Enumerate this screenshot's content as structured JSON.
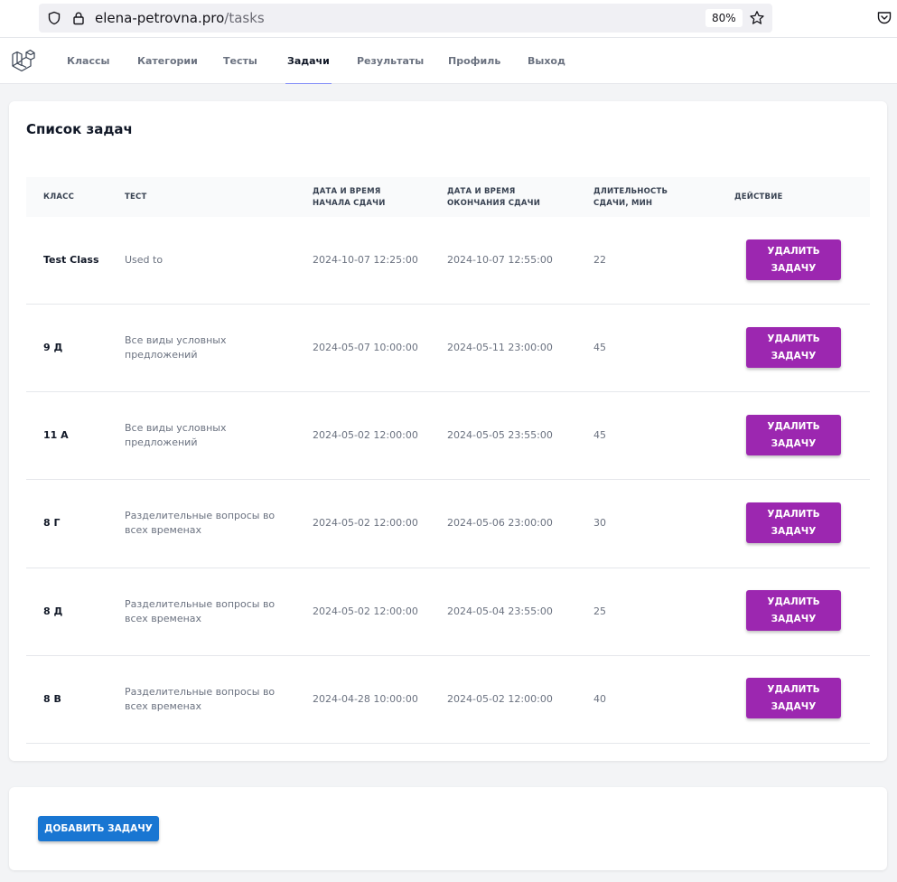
{
  "browser": {
    "url_domain": "elena-petrovna.pro",
    "url_path": "/tasks",
    "zoom": "80%"
  },
  "nav": {
    "items": [
      {
        "label": "Классы"
      },
      {
        "label": "Категории"
      },
      {
        "label": "Тесты"
      },
      {
        "label": "Задачи"
      },
      {
        "label": "Результаты"
      },
      {
        "label": "Профиль"
      },
      {
        "label": "Выход"
      }
    ],
    "active": "Задачи"
  },
  "page": {
    "title": "Список задач"
  },
  "table": {
    "headers": {
      "class": "КЛАСС",
      "test": "ТЕСТ",
      "start_1": "ДАТА И ВРЕМЯ",
      "start_2": "НАЧАЛА СДАЧИ",
      "end_1": "ДАТА И ВРЕМЯ",
      "end_2": "ОКОНЧАНИЯ СДАЧИ",
      "duration_1": "ДЛИТЕЛЬНОСТЬ",
      "duration_2": "СДАЧИ, МИН",
      "action": "ДЕЙСТВИЕ"
    },
    "rows": [
      {
        "class": "Test Class",
        "test_1": "Used to",
        "test_2": "",
        "start": "2024-10-07 12:25:00",
        "end": "2024-10-07 12:55:00",
        "duration": "22",
        "btn_1": "УДАЛИТЬ",
        "btn_2": "ЗАДАЧУ"
      },
      {
        "class": "9 Д",
        "test_1": "Все виды условных",
        "test_2": "предложений",
        "start": "2024-05-07 10:00:00",
        "end": "2024-05-11 23:00:00",
        "duration": "45",
        "btn_1": "УДАЛИТЬ",
        "btn_2": "ЗАДАЧУ"
      },
      {
        "class": "11 А",
        "test_1": "Все виды условных",
        "test_2": "предложений",
        "start": "2024-05-02 12:00:00",
        "end": "2024-05-05 23:55:00",
        "duration": "45",
        "btn_1": "УДАЛИТЬ",
        "btn_2": "ЗАДАЧУ"
      },
      {
        "class": "8 Г",
        "test_1": "Разделительные вопросы во",
        "test_2": "всех временах",
        "start": "2024-05-02 12:00:00",
        "end": "2024-05-06 23:00:00",
        "duration": "30",
        "btn_1": "УДАЛИТЬ",
        "btn_2": "ЗАДАЧУ"
      },
      {
        "class": "8 Д",
        "test_1": "Разделительные вопросы во",
        "test_2": "всех временах",
        "start": "2024-05-02 12:00:00",
        "end": "2024-05-04 23:55:00",
        "duration": "25",
        "btn_1": "УДАЛИТЬ",
        "btn_2": "ЗАДАЧУ"
      },
      {
        "class": "8 В",
        "test_1": "Разделительные вопросы во",
        "test_2": "всех временах",
        "start": "2024-04-28 10:00:00",
        "end": "2024-05-02 12:00:00",
        "duration": "40",
        "btn_1": "УДАЛИТЬ",
        "btn_2": "ЗАДАЧУ"
      }
    ]
  },
  "actions": {
    "add_task": "ДОБАВИТЬ ЗАДАЧУ"
  },
  "colors": {
    "delete_button": "#9c27b0",
    "add_button": "#1976d2",
    "nav_active_underline": "#818cf8"
  },
  "icons": {
    "url_security": "shield-icon",
    "url_lock": "lock-icon",
    "bookmark": "star-icon",
    "pocket": "pocket-icon",
    "app_logo": "laravel-logo-icon"
  }
}
